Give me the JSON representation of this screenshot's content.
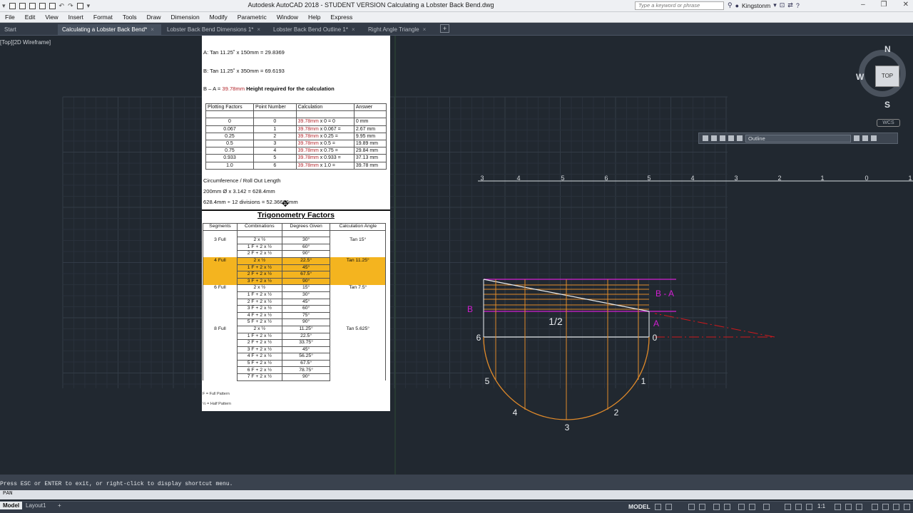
{
  "title_bar": {
    "title": "Autodesk AutoCAD 2018 - STUDENT VERSION    Calculating a Lobster Back Bend.dwg",
    "search_placeholder": "Type a keyword or phrase",
    "user_name": "Kingstonm"
  },
  "menu": [
    "File",
    "Edit",
    "View",
    "Insert",
    "Format",
    "Tools",
    "Draw",
    "Dimension",
    "Modify",
    "Parametric",
    "Window",
    "Help",
    "Express"
  ],
  "tabs": [
    {
      "label": "Start",
      "close": ""
    },
    {
      "label": "Calculating a Lobster Back Bend*",
      "close": "×",
      "active": true
    },
    {
      "label": "Lobster Back Bend Dimensions 1*",
      "close": "×"
    },
    {
      "label": "Lobster Back Bend Outline 1*",
      "close": "×"
    },
    {
      "label": "Right Angle Triangle",
      "close": "×"
    }
  ],
  "add_tab": "+",
  "viewport_label": "[Top][2D Wireframe]",
  "calc": {
    "line_a": "A:  Tan 11.25˚ x 150mm = 29.8369",
    "line_b": "B:  Tan 11.25˚ x 350mm = 69.6193",
    "ba_prefix": "B – A = ",
    "ba_value": "39.78mm",
    "ba_suffix": " Height required for the calculation",
    "circumference_title": "Circumference / Roll Out Length",
    "circumference_calc": "200mm Ø x 3.142 = 628.4mm",
    "divisions_calc": "628.4mm ÷ 12 divisions = 52.36666mm"
  },
  "plotting_table": {
    "headers": [
      "Plotting Factors",
      "Point Number",
      "Calculation",
      "Answer"
    ],
    "rows": [
      {
        "factor": "0",
        "point": "0",
        "calc_red": "39.78mm",
        "calc_rest": " x 0 = 0",
        "answer": "0 mm"
      },
      {
        "factor": "0.067",
        "point": "1",
        "calc_red": "39.78mm",
        "calc_rest": " x 0.067 =",
        "answer": "2.67 mm"
      },
      {
        "factor": "0.25",
        "point": "2",
        "calc_red": "39.78mm",
        "calc_rest": " x 0.25 =",
        "answer": "9.95 mm"
      },
      {
        "factor": "0.5",
        "point": "3",
        "calc_red": "39.78mm",
        "calc_rest": " x 0.5 =",
        "answer": "19.89 mm"
      },
      {
        "factor": "0.75",
        "point": "4",
        "calc_red": "39.78mm",
        "calc_rest": " x 0.75 =",
        "answer": "29.84 mm"
      },
      {
        "factor": "0.933",
        "point": "5",
        "calc_red": "39.78mm",
        "calc_rest": " x 0.933 =",
        "answer": "37.13 mm"
      },
      {
        "factor": "1.0",
        "point": "6",
        "calc_red": "39.78mm",
        "calc_rest": " x 1.0 =",
        "answer": "39.78 mm"
      }
    ]
  },
  "trig_title": "Trigonometry Factors",
  "trig_table": {
    "headers": [
      "Segments",
      "Combinations",
      "Degrees Given",
      "Calculation Angle"
    ],
    "rows": [
      {
        "seg": "",
        "comb": "",
        "deg": "",
        "angle": ""
      },
      {
        "seg": "3 Full",
        "comb": "2 x ½",
        "deg": "30°",
        "angle": "Tan 15°"
      },
      {
        "seg": "",
        "comb": "1 F + 2 x ½",
        "deg": "60°",
        "angle": ""
      },
      {
        "seg": "",
        "comb": "2 F + 2 x ½",
        "deg": "90°",
        "angle": ""
      },
      {
        "seg": "4 Full",
        "comb": "2 x ½",
        "deg": "22.5°",
        "angle": "Tan 11.25°",
        "hl": true
      },
      {
        "seg": "",
        "comb": "1 F + 2 x ½",
        "deg": "45°",
        "angle": "",
        "hl": true
      },
      {
        "seg": "",
        "comb": "2 F + 2 x ½",
        "deg": "67.5°",
        "angle": "",
        "hl": true
      },
      {
        "seg": "",
        "comb": "3 F + 2 x ½",
        "deg": "90°",
        "angle": "",
        "hl": true
      },
      {
        "seg": "6 Full",
        "comb": "2 x ½",
        "deg": "15°",
        "angle": "Tan 7.5°"
      },
      {
        "seg": "",
        "comb": "1 F + 2 x ½",
        "deg": "30°",
        "angle": ""
      },
      {
        "seg": "",
        "comb": "2 F + 2 x ½",
        "deg": "45°",
        "angle": ""
      },
      {
        "seg": "",
        "comb": "3 F + 2 x ½",
        "deg": "60°",
        "angle": ""
      },
      {
        "seg": "",
        "comb": "4 F + 2 x ½",
        "deg": "75°",
        "angle": ""
      },
      {
        "seg": "",
        "comb": "5 F + 2 x ½",
        "deg": "90°",
        "angle": ""
      },
      {
        "seg": "8 Full",
        "comb": "2 x ½",
        "deg": "11.25°",
        "angle": "Tan 5.625°"
      },
      {
        "seg": "",
        "comb": "1 F + 2 x ½",
        "deg": "22.5°",
        "angle": ""
      },
      {
        "seg": "",
        "comb": "2 F + 2 x ½",
        "deg": "33.75°",
        "angle": ""
      },
      {
        "seg": "",
        "comb": "3 F + 2 x ½",
        "deg": "45°",
        "angle": ""
      },
      {
        "seg": "",
        "comb": "4 F + 2 x ½",
        "deg": "56.25°",
        "angle": ""
      },
      {
        "seg": "",
        "comb": "5 F + 2 x ½",
        "deg": "67.5°",
        "angle": ""
      },
      {
        "seg": "",
        "comb": "6 F + 2 x ½",
        "deg": "78.75°",
        "angle": ""
      },
      {
        "seg": "",
        "comb": "7 F + 2 x ½",
        "deg": "90°",
        "angle": ""
      }
    ]
  },
  "footnotes": [
    "F = Full Pattern",
    "½ = Half Pattern"
  ],
  "drawing": {
    "ruler_labels": [
      "3",
      "4",
      "5",
      "6",
      "5",
      "4",
      "3",
      "2",
      "1",
      "0",
      "1"
    ],
    "label_b": "B",
    "label_ba": "B - A",
    "label_a": "A",
    "label_half": "1/2",
    "end_labels": [
      "6",
      "0"
    ],
    "point_labels": [
      "5",
      "4",
      "3",
      "2",
      "1"
    ]
  },
  "viewcube": {
    "n": "N",
    "s": "S",
    "w": "W",
    "face": "TOP",
    "wcs": "WCS"
  },
  "layer": {
    "name": "Outline"
  },
  "command": {
    "message": "Press ESC or ENTER to exit, or right-click to display shortcut menu.",
    "prompt": "PAN"
  },
  "layout_tabs": [
    "Model",
    "Layout1",
    "+"
  ],
  "status": {
    "model": "MODEL",
    "scale": "1:1"
  },
  "colors": {
    "magenta": "#d21fd2",
    "orange": "#e08a2a",
    "red": "#d0181c",
    "highlight": "#f4b41f"
  }
}
